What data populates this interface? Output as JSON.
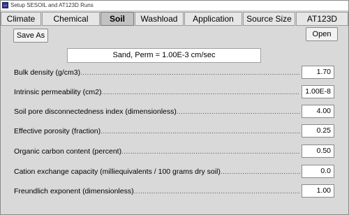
{
  "window": {
    "title": "Setup SESOIL and AT123D Runs"
  },
  "tabs": [
    "Climate",
    "Chemical",
    "Soil",
    "Washload",
    "Application",
    "Source Size",
    "AT123D"
  ],
  "active_tab": "Soil",
  "buttons": {
    "save_as": "Save As",
    "open": "Open"
  },
  "soil_description": "Sand, Perm = 1.00E-3 cm/sec",
  "fields": [
    {
      "label": "Bulk density (g/cm3)",
      "value": "1.70"
    },
    {
      "label": "Intrinsic permeability (cm2)",
      "value": "1.00E-8"
    },
    {
      "label": "Soil pore disconnectedness index (dimensionless)",
      "value": "4.00"
    },
    {
      "label": "Effective porosity (fraction)",
      "value": "0.25"
    },
    {
      "label": "Organic carbon content (percent)",
      "value": "0.50"
    },
    {
      "label": "Cation exchange capacity (milliequivalents / 100 grams dry soil)",
      "value": "0.0"
    },
    {
      "label": "Freundlich exponent (dimensionless)",
      "value": "1.00"
    }
  ]
}
